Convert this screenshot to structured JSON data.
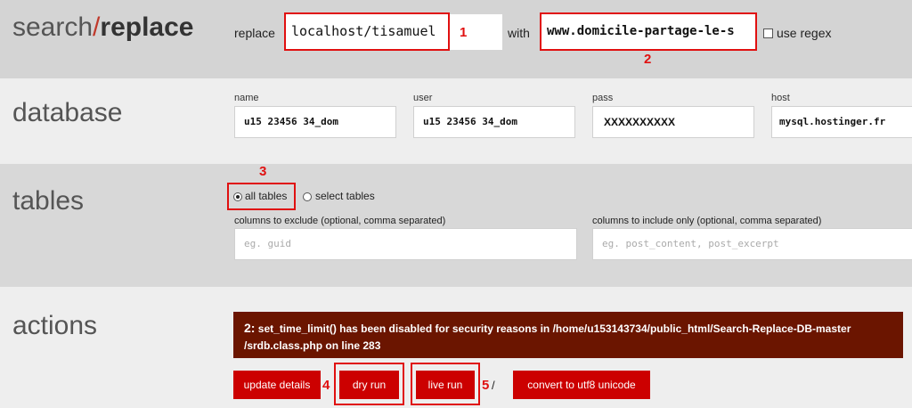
{
  "header": {
    "brand_search": "search",
    "brand_slash": "/",
    "brand_replace": "replace",
    "replace_label": "replace",
    "replace_value": "localhost/tisamuel",
    "with_label": "with",
    "with_value": "www.domicile-partage-le-s",
    "use_regex_label": "use regex",
    "use_regex_checked": false
  },
  "database": {
    "title": "database",
    "name_label": "name",
    "name_value": "u15 23456 34_dom",
    "user_label": "user",
    "user_value": "u15 23456 34_dom",
    "pass_label": "pass",
    "pass_value": "XXXXXXXXXX",
    "host_label": "host",
    "host_value": "mysql.hostinger.fr"
  },
  "tables": {
    "title": "tables",
    "all_tables_label": "all tables",
    "select_tables_label": "select tables",
    "selected": "all tables",
    "exclude_label": "columns to exclude (optional, comma separated)",
    "exclude_placeholder": "eg. guid",
    "include_label": "columns to include only (optional, comma separated)",
    "include_placeholder": "eg. post_content, post_excerpt"
  },
  "actions": {
    "title": "actions",
    "error_prefix": "2:",
    "error_line1": "set_time_limit() has been disabled for security reasons in /home/u153143734/public_html/Search-Replace-DB-master",
    "error_line2": "/srdb.class.php on line 283",
    "update_details_label": "update details",
    "dry_run_label": "dry run",
    "live_run_label": "live run",
    "separator": "/",
    "convert_label": "convert to utf8 unicode"
  },
  "annotations": [
    "1",
    "2",
    "3",
    "4",
    "5"
  ],
  "colors": {
    "accent": "#cc0000",
    "error_bg": "#6b1500",
    "annotation": "#e01010"
  }
}
